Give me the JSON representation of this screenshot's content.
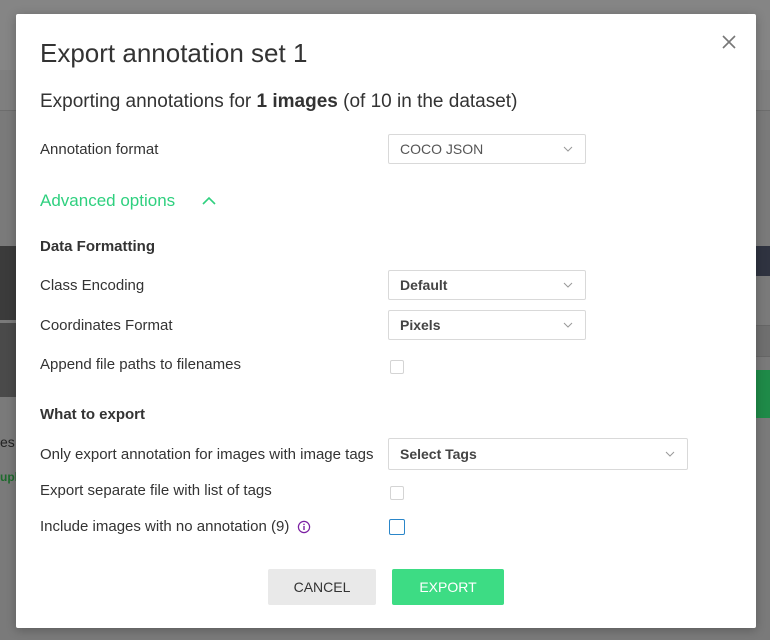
{
  "background": {
    "left_text_1": "es",
    "left_text_2": "upl"
  },
  "dialog": {
    "title": "Export annotation set 1",
    "subtitle_prefix": "Exporting annotations for ",
    "subtitle_bold": "1 images",
    "subtitle_suffix": " (of 10 in the dataset)",
    "annotation_format_label": "Annotation format",
    "annotation_format_value": "COCO JSON",
    "advanced_options_label": "Advanced options",
    "data_formatting_heading": "Data Formatting",
    "class_encoding_label": "Class Encoding",
    "class_encoding_value": "Default",
    "coordinates_format_label": "Coordinates Format",
    "coordinates_format_value": "Pixels",
    "append_paths_label": "Append file paths to filenames",
    "append_paths_checked": false,
    "what_to_export_heading": "What to export",
    "only_tags_label": "Only export annotation for images with image tags",
    "only_tags_placeholder": "Select Tags",
    "separate_file_label": "Export separate file with list of tags",
    "separate_file_checked": false,
    "include_no_annotation_label": "Include images with no annotation (9)",
    "include_no_annotation_checked": false,
    "cancel_label": "CANCEL",
    "export_label": "EXPORT"
  },
  "colors": {
    "accent": "#3ddc84",
    "link_green": "#2fd07f",
    "info_icon": "#7b1fa2",
    "focus_border": "#2a86c9"
  }
}
